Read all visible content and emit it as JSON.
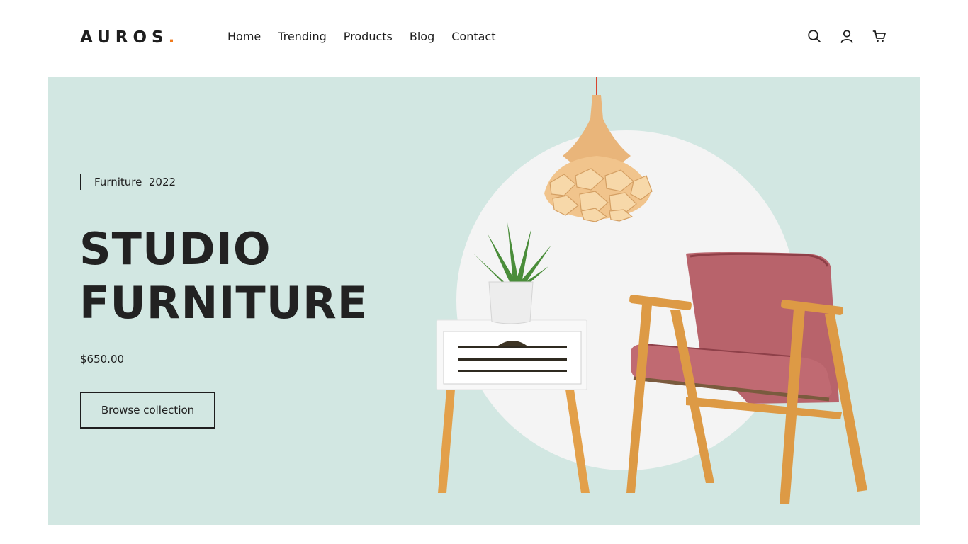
{
  "brand": {
    "name": "AUROS",
    "dot": ".",
    "accent_color": "#f07a1c"
  },
  "nav": {
    "items": [
      {
        "label": "Home"
      },
      {
        "label": "Trending"
      },
      {
        "label": "Products"
      },
      {
        "label": "Blog"
      },
      {
        "label": "Contact"
      }
    ]
  },
  "header_icons": [
    "search-icon",
    "user-icon",
    "cart-icon"
  ],
  "hero": {
    "tagline": "Furniture  2022",
    "title_line1": "STUDIO",
    "title_line2": "FURNITURE",
    "price": "$650.00",
    "cta_label": "Browse collection",
    "background_color": "#d2e7e2",
    "images": [
      "pendant-lamp",
      "potted-aloe-plant",
      "white-side-table",
      "pink-armchair"
    ]
  }
}
